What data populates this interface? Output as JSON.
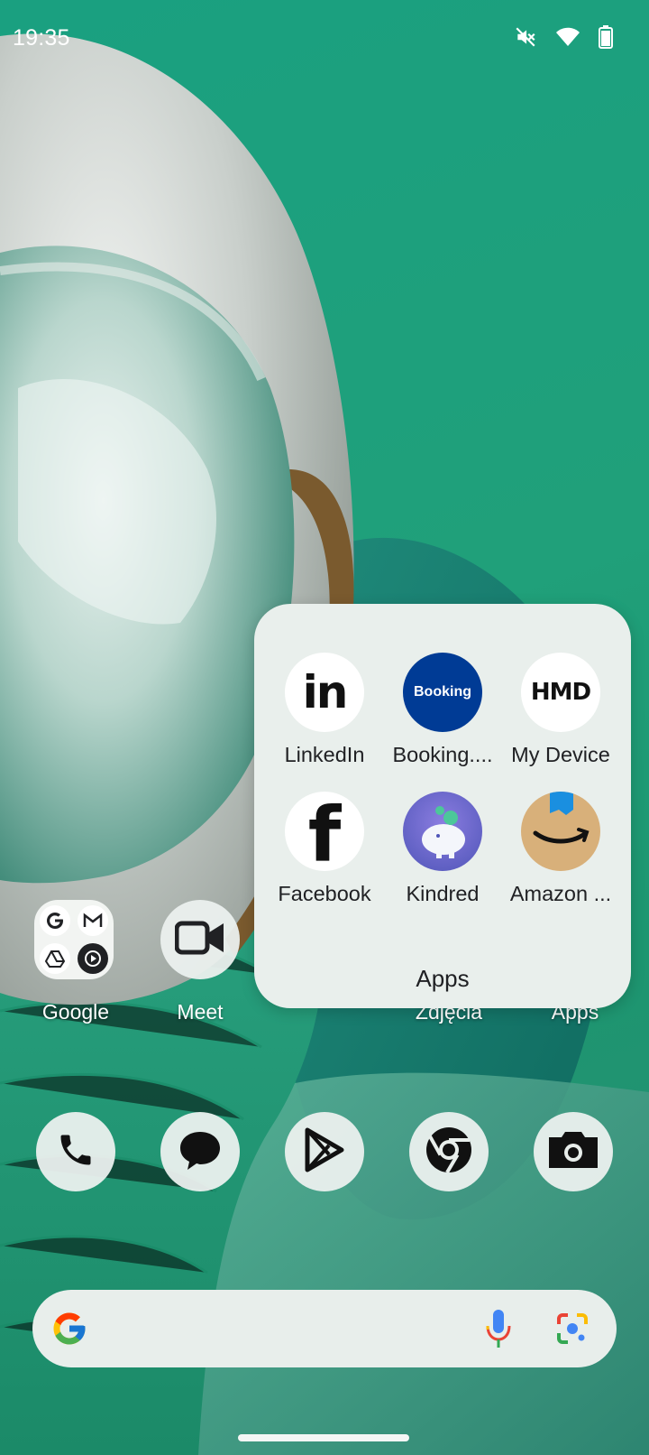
{
  "status_bar": {
    "time": "19:35",
    "icons": [
      "mute-icon",
      "wifi-icon",
      "battery-icon"
    ]
  },
  "home": {
    "row": [
      {
        "label": "Google",
        "type": "folder",
        "mini_icons": [
          "google-g-icon",
          "gmail-icon",
          "drive-icon",
          "youtube-music-icon"
        ]
      },
      {
        "label": "Meet",
        "icon": "video-camera-icon"
      },
      {
        "label": "Zdjęcia"
      },
      {
        "label": "Apps"
      }
    ]
  },
  "folder_popup": {
    "title": "Apps",
    "apps": [
      {
        "label": "LinkedIn",
        "icon": "linkedin-icon",
        "icon_text": "in"
      },
      {
        "label": "Booking....",
        "icon": "booking-icon",
        "icon_text": "Booking"
      },
      {
        "label": "My Device",
        "icon": "hmd-icon",
        "icon_text": "HMD"
      },
      {
        "label": "Facebook",
        "icon": "facebook-icon",
        "icon_text": "f"
      },
      {
        "label": "Kindred",
        "icon": "kindred-piggy-bank-icon"
      },
      {
        "label": "Amazon ...",
        "icon": "amazon-icon"
      }
    ]
  },
  "dock": {
    "items": [
      "phone-icon",
      "messages-icon",
      "play-store-icon",
      "chrome-icon",
      "camera-icon"
    ]
  },
  "search_bar": {
    "icons": [
      "google-g-icon",
      "microphone-icon",
      "google-lens-icon"
    ]
  },
  "colors": {
    "wallpaper": "#1f9b72",
    "popup_bg": "#e9efec",
    "booking": "#003b95",
    "kindred": "#6a5fc8",
    "amazon": "#d8b07a"
  }
}
